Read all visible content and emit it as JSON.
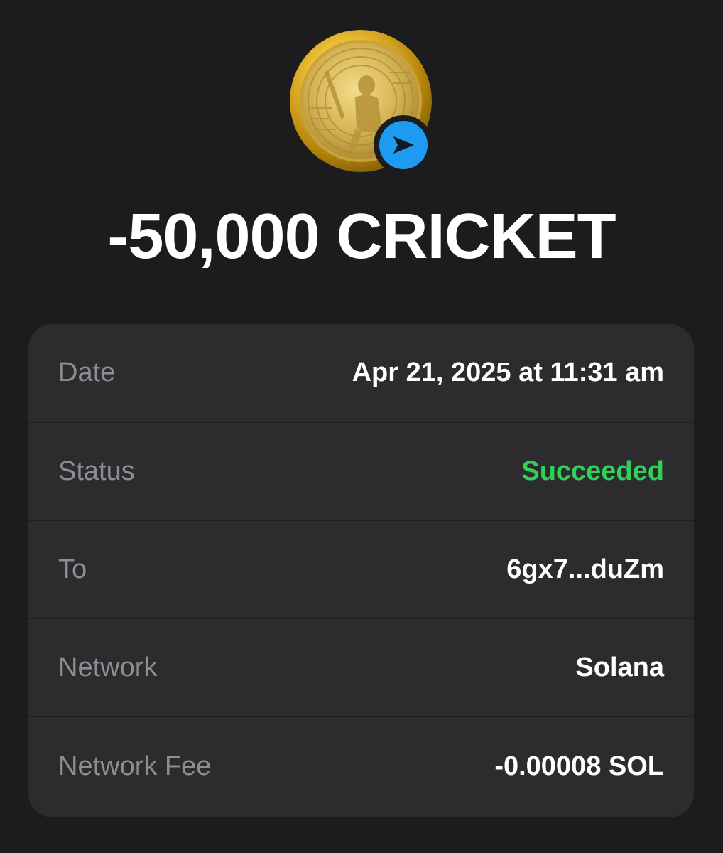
{
  "token": {
    "icon": "cricket-coin-icon",
    "badge_icon": "send-arrow-icon",
    "amount": "-50,000 CRICKET"
  },
  "colors": {
    "background": "#1c1c1e",
    "card": "#2c2c2e",
    "label": "#8d8d92",
    "success": "#30d158",
    "badge": "#1d9bf0",
    "coin_gold": "#d4a82a"
  },
  "details": [
    {
      "label": "Date",
      "value": "Apr 21, 2025 at 11:31 am"
    },
    {
      "label": "Status",
      "value": "Succeeded"
    },
    {
      "label": "To",
      "value": "6gx7...duZm"
    },
    {
      "label": "Network",
      "value": "Solana"
    },
    {
      "label": "Network Fee",
      "value": "-0.00008 SOL"
    }
  ]
}
